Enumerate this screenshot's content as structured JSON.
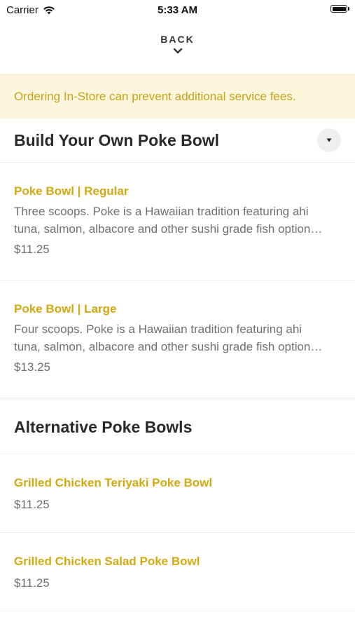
{
  "status_bar": {
    "carrier": "Carrier",
    "time": "5:33 AM"
  },
  "nav": {
    "back_label": "BACK"
  },
  "banner": {
    "text": "Ordering In-Store can prevent additional service fees."
  },
  "sections": [
    {
      "title": "Build Your Own Poke Bowl",
      "items": [
        {
          "name": "Poke Bowl | Regular",
          "description_line1": "Three scoops. Poke is a Hawaiian tradition featuring ahi",
          "description_line2": "tuna, salmon, albacore and other sushi grade fish option…",
          "price": "$11.25"
        },
        {
          "name": "Poke Bowl | Large",
          "description_line1": "Four scoops. Poke is a Hawaiian tradition featuring ahi",
          "description_line2": "tuna, salmon, albacore and other sushi grade fish option…",
          "price": "$13.25"
        }
      ]
    },
    {
      "title": "Alternative Poke Bowls",
      "items": [
        {
          "name": "Grilled Chicken Teriyaki Poke Bowl",
          "price": "$11.25"
        },
        {
          "name": "Grilled Chicken Salad Poke Bowl",
          "price": "$11.25"
        }
      ]
    }
  ],
  "colors": {
    "accent": "#d4a90f",
    "banner_bg": "#fbf6dc",
    "banner_text": "#c9a21a"
  },
  "icons": {
    "wifi": "wifi-icon",
    "battery": "battery-icon",
    "back": "chevron-down-icon",
    "collapse": "caret-down-icon"
  }
}
